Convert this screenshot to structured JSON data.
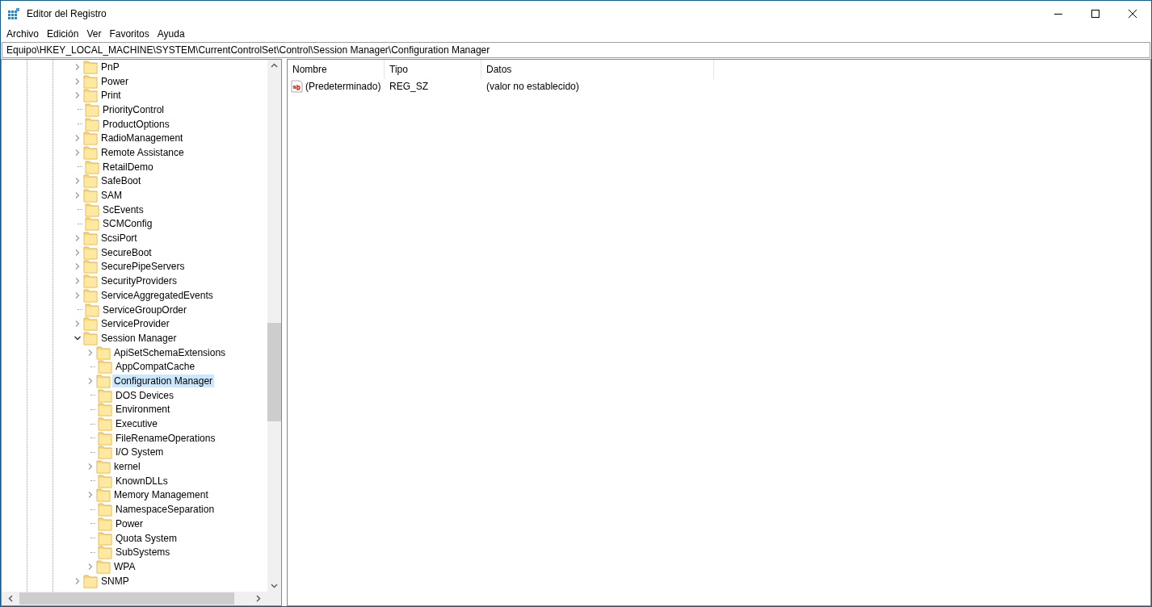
{
  "window": {
    "title": "Editor del Registro"
  },
  "menu": [
    "Archivo",
    "Edición",
    "Ver",
    "Favoritos",
    "Ayuda"
  ],
  "address": "Equipo\\HKEY_LOCAL_MACHINE\\SYSTEM\\CurrentControlSet\\Control\\Session Manager\\Configuration Manager",
  "tree": {
    "items": [
      {
        "label": "PnP",
        "kind": "expandable",
        "expanded": false,
        "selected": false
      },
      {
        "label": "Power",
        "kind": "expandable",
        "expanded": false,
        "selected": false
      },
      {
        "label": "Print",
        "kind": "expandable",
        "expanded": false,
        "selected": false
      },
      {
        "label": "PriorityControl",
        "kind": "leaf",
        "selected": false
      },
      {
        "label": "ProductOptions",
        "kind": "leaf",
        "selected": false
      },
      {
        "label": "RadioManagement",
        "kind": "expandable",
        "expanded": false,
        "selected": false
      },
      {
        "label": "Remote Assistance",
        "kind": "expandable",
        "expanded": false,
        "selected": false
      },
      {
        "label": "RetailDemo",
        "kind": "leaf",
        "selected": false
      },
      {
        "label": "SafeBoot",
        "kind": "expandable",
        "expanded": false,
        "selected": false
      },
      {
        "label": "SAM",
        "kind": "expandable",
        "expanded": false,
        "selected": false
      },
      {
        "label": "ScEvents",
        "kind": "leaf",
        "selected": false
      },
      {
        "label": "SCMConfig",
        "kind": "leaf",
        "selected": false
      },
      {
        "label": "ScsiPort",
        "kind": "expandable",
        "expanded": false,
        "selected": false
      },
      {
        "label": "SecureBoot",
        "kind": "expandable",
        "expanded": false,
        "selected": false
      },
      {
        "label": "SecurePipeServers",
        "kind": "expandable",
        "expanded": false,
        "selected": false
      },
      {
        "label": "SecurityProviders",
        "kind": "expandable",
        "expanded": false,
        "selected": false
      },
      {
        "label": "ServiceAggregatedEvents",
        "kind": "expandable",
        "expanded": false,
        "selected": false
      },
      {
        "label": "ServiceGroupOrder",
        "kind": "leaf",
        "selected": false
      },
      {
        "label": "ServiceProvider",
        "kind": "expandable",
        "expanded": false,
        "selected": false
      },
      {
        "label": "Session Manager",
        "kind": "expandable",
        "expanded": true,
        "selected": false,
        "children": [
          {
            "label": "ApiSetSchemaExtensions",
            "kind": "expandable",
            "expanded": false,
            "selected": false
          },
          {
            "label": "AppCompatCache",
            "kind": "leaf",
            "selected": false
          },
          {
            "label": "Configuration Manager",
            "kind": "expandable",
            "expanded": false,
            "selected": true
          },
          {
            "label": "DOS Devices",
            "kind": "leaf",
            "selected": false
          },
          {
            "label": "Environment",
            "kind": "leaf",
            "selected": false
          },
          {
            "label": "Executive",
            "kind": "leaf",
            "selected": false
          },
          {
            "label": "FileRenameOperations",
            "kind": "leaf",
            "selected": false
          },
          {
            "label": "I/O System",
            "kind": "leaf",
            "selected": false
          },
          {
            "label": "kernel",
            "kind": "expandable",
            "expanded": false,
            "selected": false
          },
          {
            "label": "KnownDLLs",
            "kind": "leaf",
            "selected": false
          },
          {
            "label": "Memory Management",
            "kind": "expandable",
            "expanded": false,
            "selected": false
          },
          {
            "label": "NamespaceSeparation",
            "kind": "leaf",
            "selected": false
          },
          {
            "label": "Power",
            "kind": "leaf",
            "selected": false
          },
          {
            "label": "Quota System",
            "kind": "leaf",
            "selected": false
          },
          {
            "label": "SubSystems",
            "kind": "leaf",
            "selected": false
          },
          {
            "label": "WPA",
            "kind": "expandable",
            "expanded": false,
            "selected": false
          }
        ]
      },
      {
        "label": "SNMP",
        "kind": "expandable",
        "expanded": false,
        "selected": false
      }
    ]
  },
  "values": {
    "columns": [
      "Nombre",
      "Tipo",
      "Datos"
    ],
    "rows": [
      {
        "name": "(Predeterminado)",
        "type": "REG_SZ",
        "data": "(valor no establecido)"
      }
    ]
  }
}
